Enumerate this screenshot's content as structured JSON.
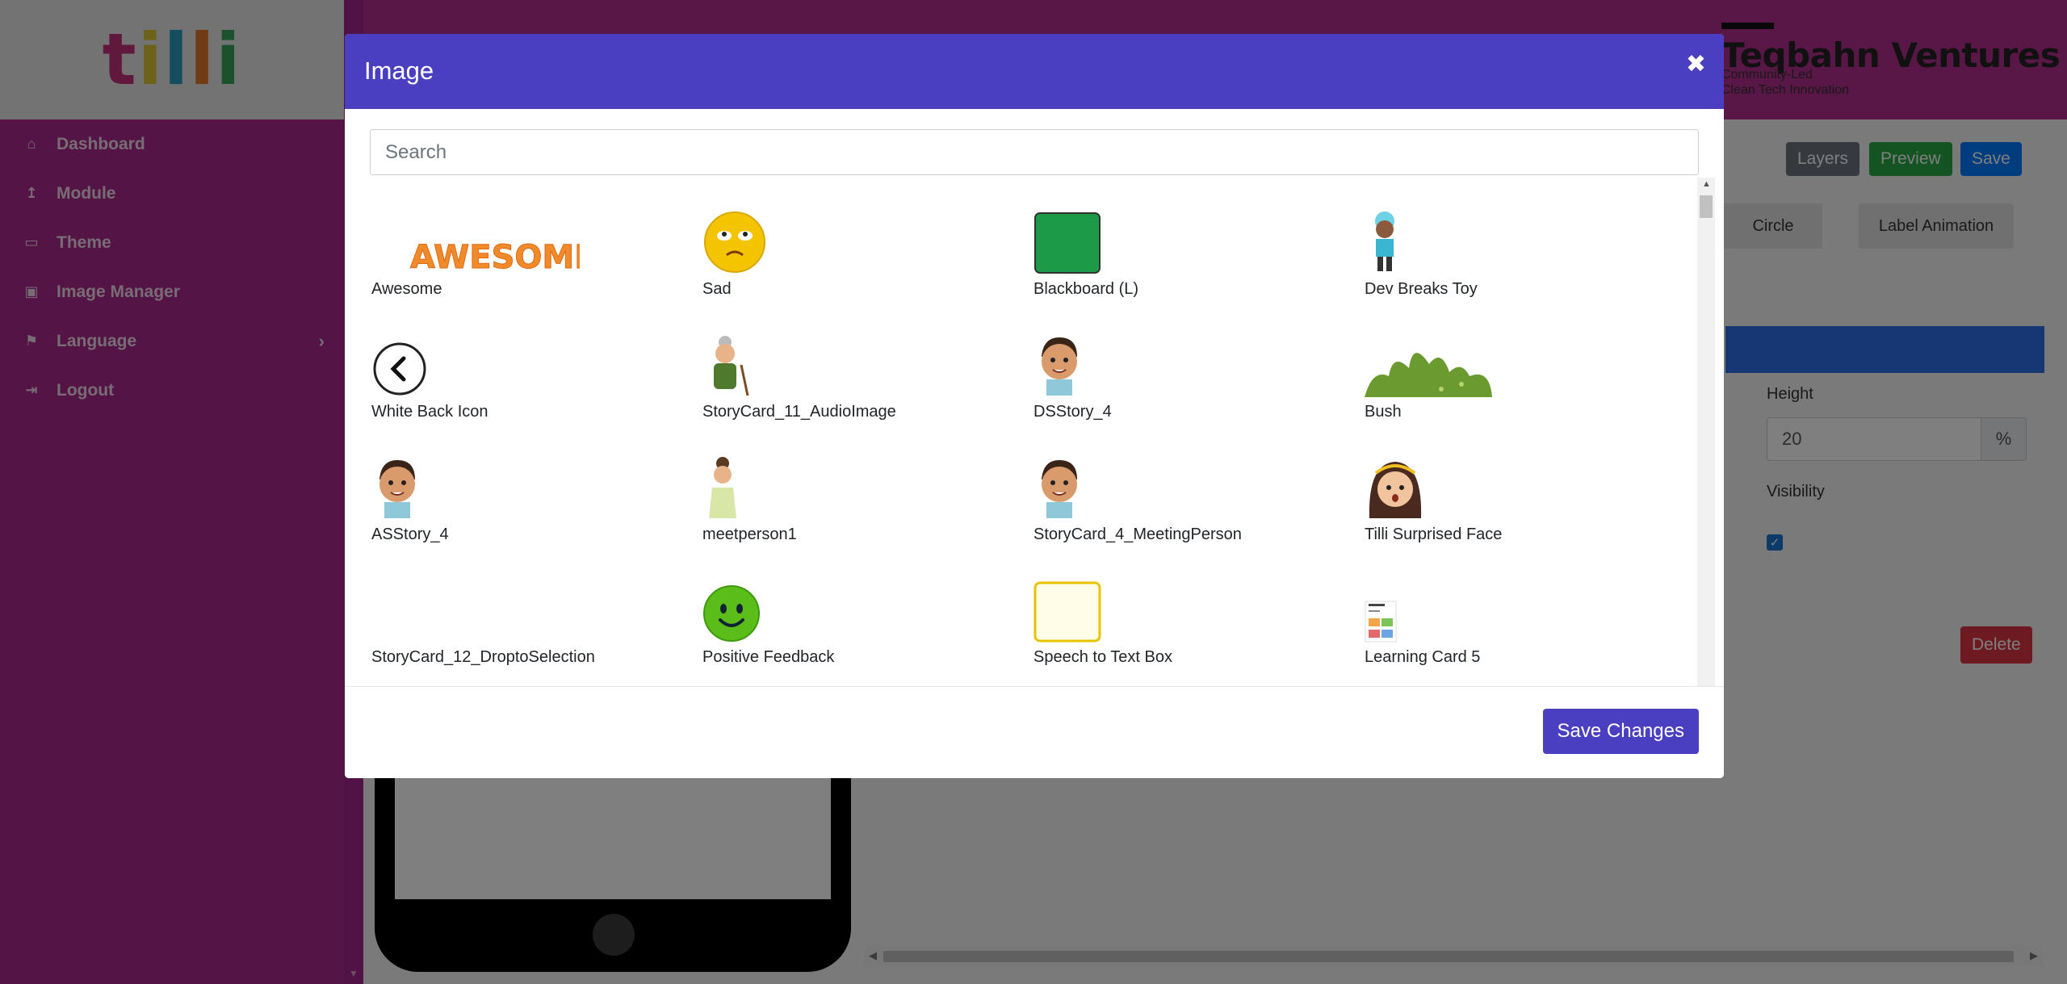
{
  "logo": {
    "letters": [
      "t",
      "i",
      "l",
      "l",
      "i"
    ],
    "colors": [
      "#c2307a",
      "#d9c533",
      "#2a9cc2",
      "#e0762a",
      "#37a45a"
    ]
  },
  "sidebar": {
    "items": [
      {
        "label": "Dashboard",
        "icon": "home-icon"
      },
      {
        "label": "Module",
        "icon": "upload-icon"
      },
      {
        "label": "Theme",
        "icon": "monitor-icon"
      },
      {
        "label": "Image Manager",
        "icon": "image-icon"
      },
      {
        "label": "Language",
        "icon": "language-icon",
        "has_submenu": true
      },
      {
        "label": "Logout",
        "icon": "logout-icon"
      }
    ]
  },
  "brand": {
    "name": "Teqbahn Ventures",
    "tagline_1": "Community-Led",
    "tagline_2": "Clean Tech Innovation"
  },
  "toolbar": {
    "layers": "Layers",
    "preview": "Preview",
    "save": "Save"
  },
  "editor": {
    "circle_label": "Circle",
    "label_animation": "Label Animation",
    "height_label": "Height",
    "height_value": "20",
    "height_unit": "%",
    "visibility_label": "Visibility",
    "visibility_checked": true,
    "delete_label": "Delete"
  },
  "modal": {
    "title": "Image",
    "close_symbol": "✖",
    "search_placeholder": "Search",
    "search_value": "",
    "save_changes": "Save Changes",
    "images": [
      {
        "name": "Awesome",
        "thumb": "awesome-text"
      },
      {
        "name": "Sad",
        "thumb": "sad-face"
      },
      {
        "name": "Blackboard (L)",
        "thumb": "green-board"
      },
      {
        "name": "Dev Breaks Toy",
        "thumb": "boy-figure"
      },
      {
        "name": "White Back Icon",
        "thumb": "back-circle"
      },
      {
        "name": "StoryCard_11_AudioImage",
        "thumb": "grandma"
      },
      {
        "name": "DSStory_4",
        "thumb": "boy-face"
      },
      {
        "name": "Bush",
        "thumb": "bush"
      },
      {
        "name": "ASStory_4",
        "thumb": "boy-face"
      },
      {
        "name": "meetperson1",
        "thumb": "woman"
      },
      {
        "name": "StoryCard_4_MeetingPerson",
        "thumb": "boy-face"
      },
      {
        "name": "Tilli Surprised Face",
        "thumb": "girl-face"
      },
      {
        "name": "StoryCard_12_DroptoSelection",
        "thumb": "none"
      },
      {
        "name": "Positive Feedback",
        "thumb": "happy-face"
      },
      {
        "name": "Speech to Text Box",
        "thumb": "yellow-box"
      },
      {
        "name": "Learning Card 5",
        "thumb": "mini-card"
      }
    ]
  }
}
